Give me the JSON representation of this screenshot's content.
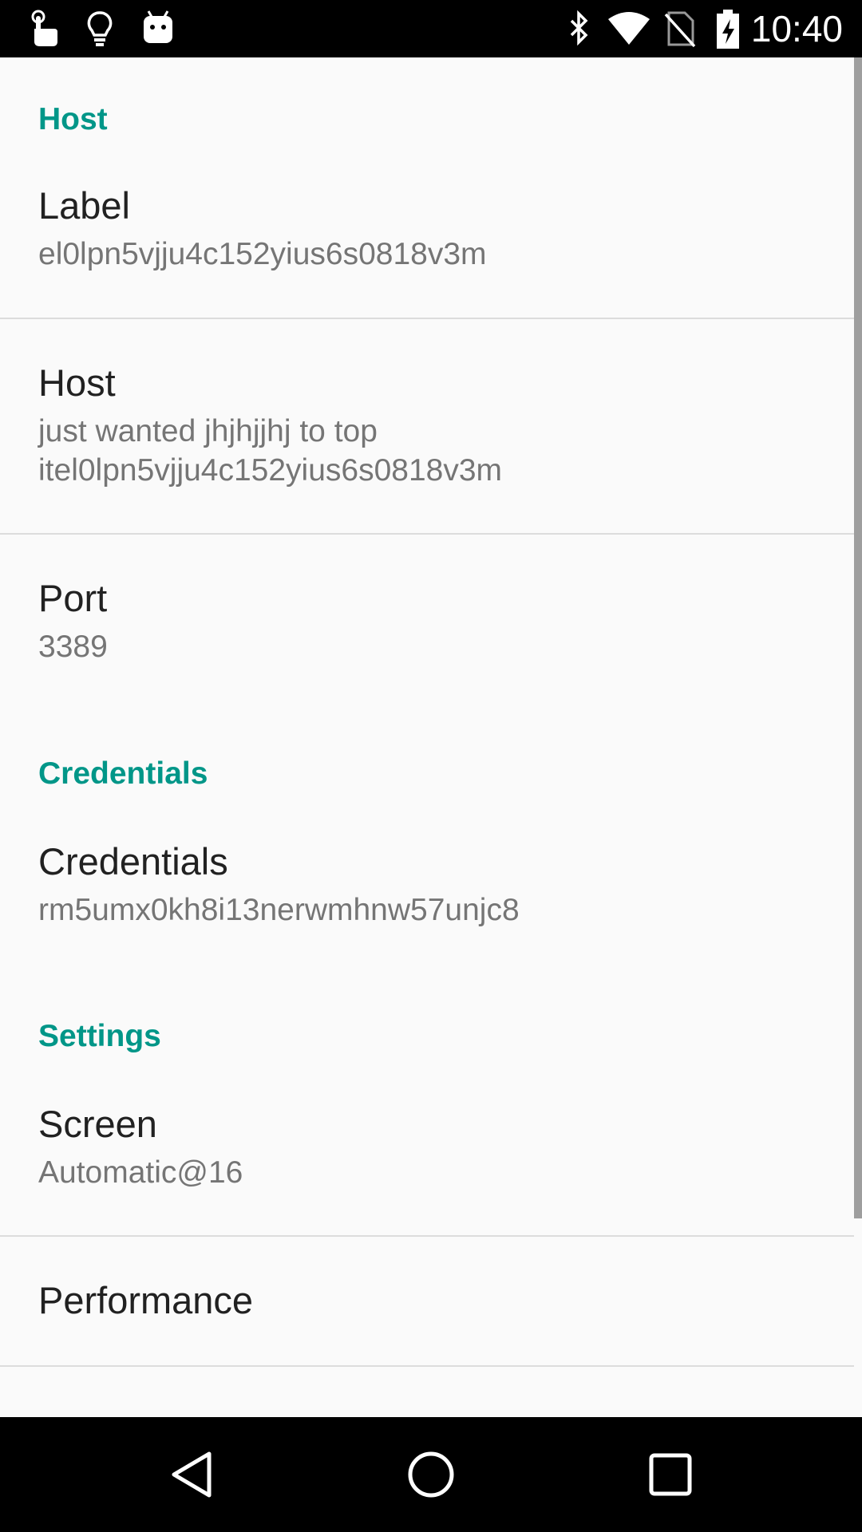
{
  "status_bar": {
    "time": "10:40",
    "left_icons": [
      "touch-app-icon",
      "lightbulb-icon",
      "android-icon"
    ],
    "right_icons": [
      "bluetooth-icon",
      "wifi-icon",
      "no-sim-icon",
      "battery-charging-icon"
    ]
  },
  "sections": {
    "host": {
      "header": "Host"
    },
    "credentials": {
      "header": "Credentials"
    },
    "settings": {
      "header": "Settings"
    }
  },
  "prefs": {
    "label": {
      "title": "Label",
      "summary": "el0lpn5vjju4c152yius6s0818v3m"
    },
    "host": {
      "title": "Host",
      "summary_line1": "just wanted jhjhjjhj to top",
      "summary_line2": "itel0lpn5vjju4c152yius6s0818v3m"
    },
    "port": {
      "title": "Port",
      "summary": "3389"
    },
    "credentials": {
      "title": "Credentials",
      "summary": "rm5umx0kh8i13nerwmhnw57unjc8"
    },
    "screen": {
      "title": "Screen",
      "summary": "Automatic@16"
    },
    "performance": {
      "title": "Performance"
    }
  },
  "nav_bar": {
    "buttons": [
      "back-icon",
      "home-icon",
      "recents-icon"
    ]
  },
  "colors": {
    "accent": "#009688",
    "title": "#212121",
    "summary": "#757575",
    "background": "#fafafa",
    "divider": "#dcdcdc"
  }
}
